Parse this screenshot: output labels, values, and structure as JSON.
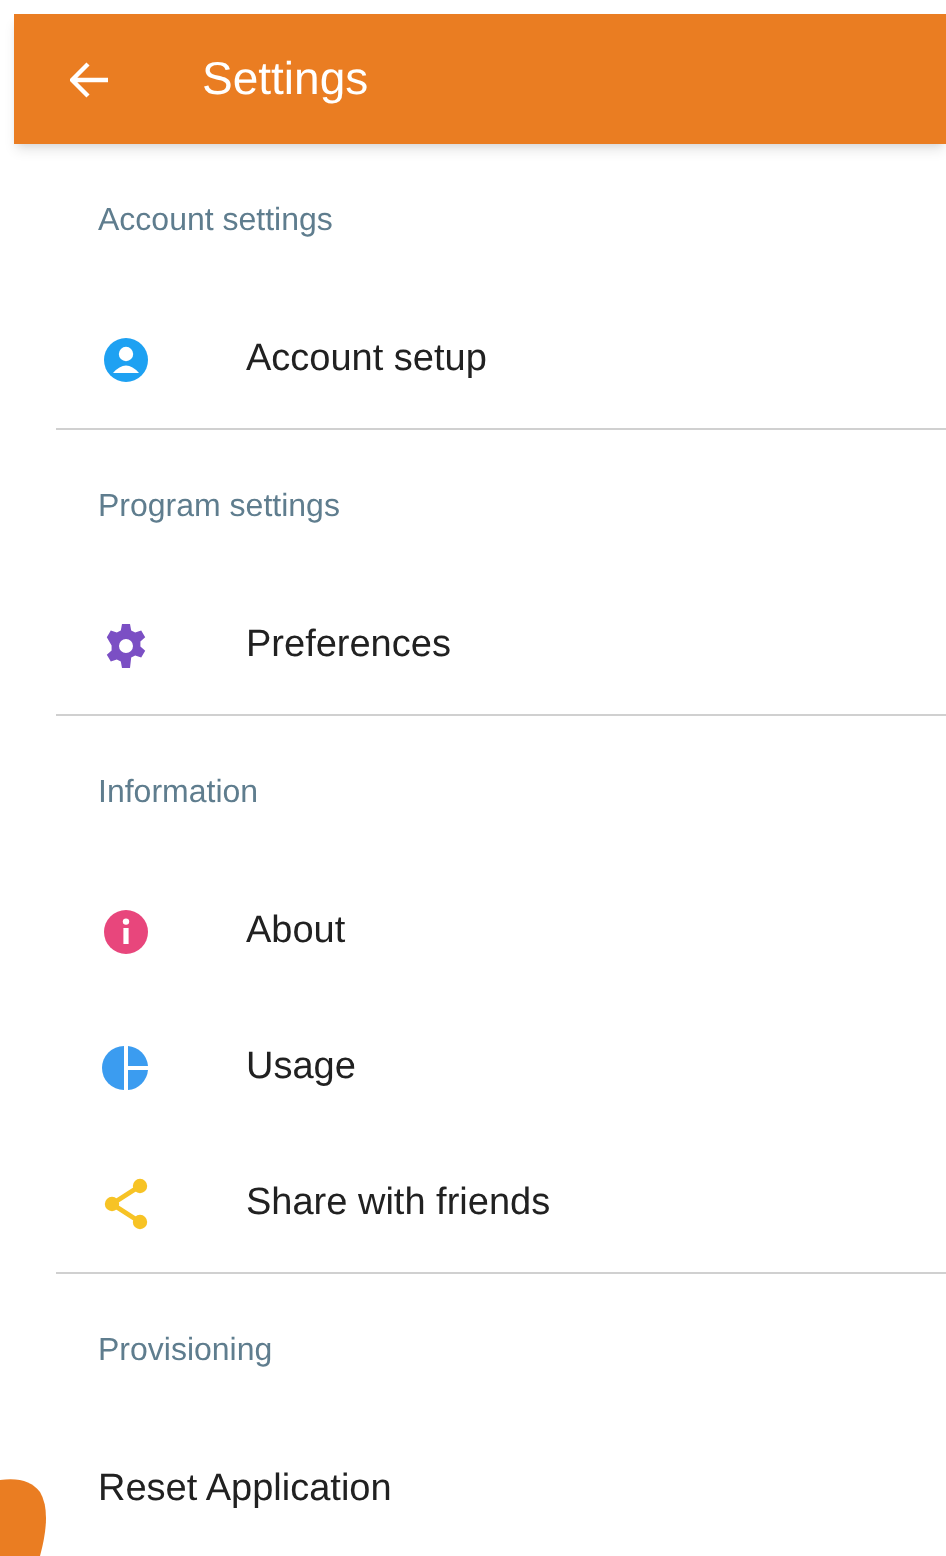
{
  "app_bar": {
    "title": "Settings"
  },
  "sections": [
    {
      "title": "Account settings",
      "items": [
        {
          "label": "Account setup",
          "kind": "account"
        }
      ]
    },
    {
      "title": "Program settings",
      "items": [
        {
          "label": "Preferences",
          "kind": "preferences"
        }
      ]
    },
    {
      "title": "Information",
      "items": [
        {
          "label": "About",
          "kind": "about"
        },
        {
          "label": "Usage",
          "kind": "usage"
        },
        {
          "label": "Share with friends",
          "kind": "share"
        }
      ]
    },
    {
      "title": "Provisioning",
      "items": [
        {
          "label": "Reset Application",
          "kind": "plain"
        }
      ]
    }
  ]
}
